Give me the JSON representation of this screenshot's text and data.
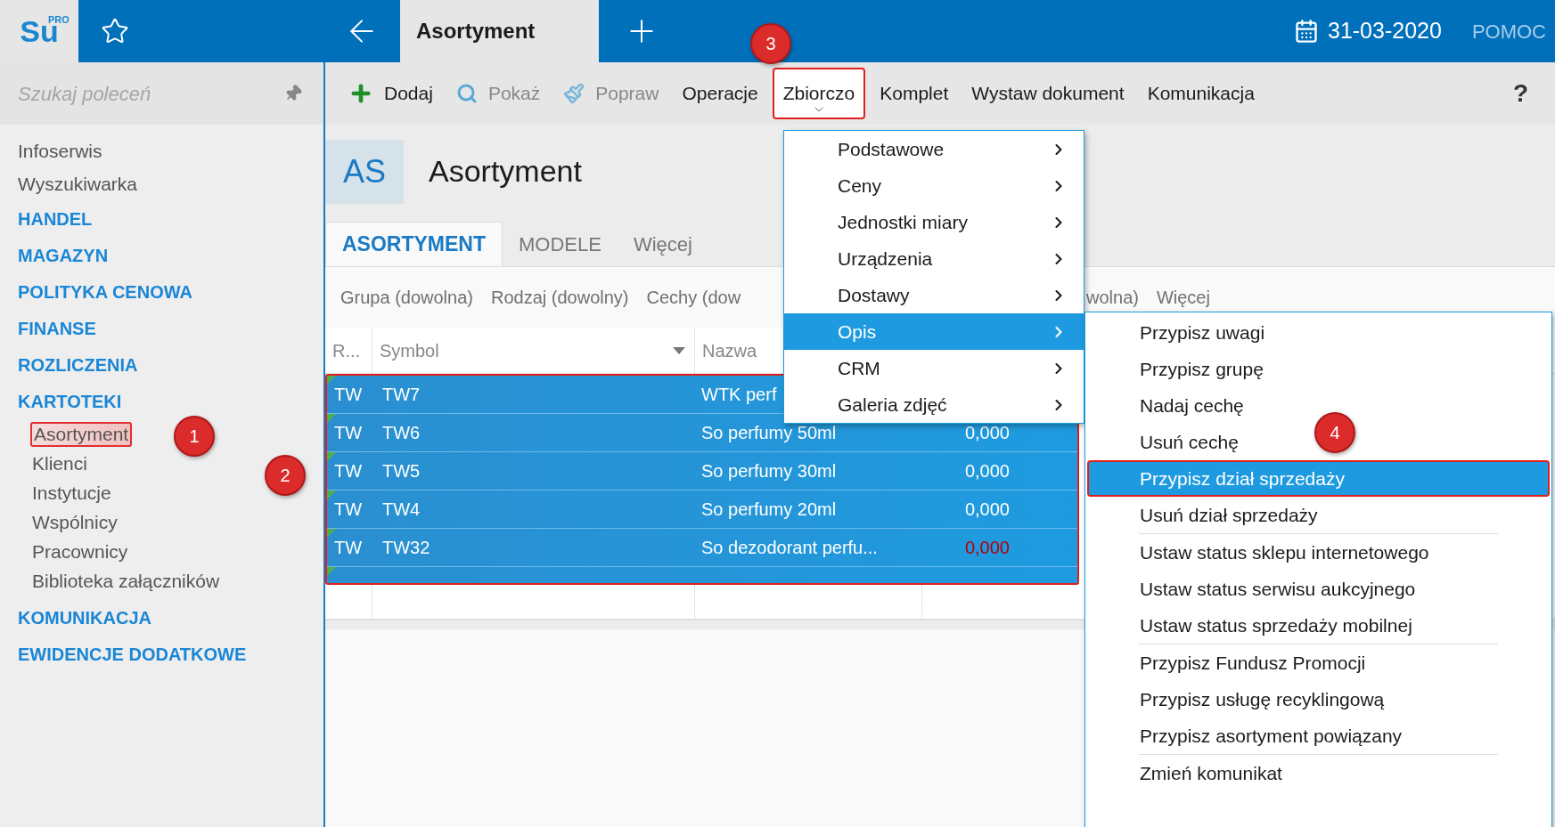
{
  "app": {
    "logo": "Su",
    "logo_badge": "PRO"
  },
  "top_bar": {
    "tab": "Asortyment",
    "date": "31-03-2020",
    "help": "POMOC"
  },
  "sidebar": {
    "search": {
      "placeholder": "Szukaj poleceń"
    },
    "items": [
      {
        "label": "Infoserwis",
        "kind": "link"
      },
      {
        "label": "Wyszukiwarka",
        "kind": "link"
      },
      {
        "label": "HANDEL",
        "kind": "section"
      },
      {
        "label": "MAGAZYN",
        "kind": "section"
      },
      {
        "label": "POLITYKA CENOWA",
        "kind": "section"
      },
      {
        "label": "FINANSE",
        "kind": "section"
      },
      {
        "label": "ROZLICZENIA",
        "kind": "section"
      },
      {
        "label": "KARTOTEKI",
        "kind": "section",
        "children": [
          {
            "label": "Asortyment",
            "highlighted": true
          },
          {
            "label": "Klienci",
            "highlighted": false
          },
          {
            "label": "Instytucje",
            "highlighted": false
          },
          {
            "label": "Wspólnicy",
            "highlighted": false
          },
          {
            "label": "Pracownicy",
            "highlighted": false
          },
          {
            "label": "Biblioteka załączników",
            "highlighted": false
          }
        ]
      },
      {
        "label": "KOMUNIKACJA",
        "kind": "section"
      },
      {
        "label": "EWIDENCJE DODATKOWE",
        "kind": "section"
      }
    ]
  },
  "toolbar": {
    "items": [
      {
        "label": "Dodaj",
        "kind": "add",
        "disabled": false,
        "highlighted": false
      },
      {
        "label": "Pokaż",
        "kind": "search",
        "disabled": true,
        "highlighted": false
      },
      {
        "label": "Popraw",
        "kind": "edit",
        "disabled": true,
        "highlighted": false
      },
      {
        "label": "Operacje",
        "kind": "plain",
        "disabled": false,
        "highlighted": false
      },
      {
        "label": "Zbiorczo",
        "kind": "dropdown",
        "disabled": false,
        "highlighted": true
      },
      {
        "label": "Komplet",
        "kind": "plain",
        "disabled": false,
        "highlighted": false
      },
      {
        "label": "Wystaw dokument",
        "kind": "plain",
        "disabled": false,
        "highlighted": false
      },
      {
        "label": "Komunikacja",
        "kind": "plain",
        "disabled": false,
        "highlighted": false
      }
    ],
    "help": "?"
  },
  "page": {
    "badge": "AS",
    "title": "Asortyment",
    "tabs": [
      {
        "label": "ASORTYMENT",
        "selected": true
      },
      {
        "label": "MODELE",
        "selected": false
      },
      {
        "label": "Więcej",
        "selected": false
      }
    ],
    "filters_left": [
      "Grupa (dowolna)",
      "Rodzaj (dowolny)",
      "Cechy (dow"
    ],
    "filters_right": [
      "wolna)",
      "Więcej"
    ]
  },
  "table": {
    "columns": [
      {
        "label": "R...",
        "sorted": false
      },
      {
        "label": "Symbol",
        "sorted": true
      },
      {
        "label": "Nazwa",
        "sorted": false
      }
    ],
    "outlined": true,
    "rows": [
      {
        "type": "TW",
        "symbol": "TW7",
        "name": "WTK perf",
        "selected": true
      },
      {
        "type": "TW",
        "symbol": "TW6",
        "name": "So perfumy 50ml",
        "value": "0,000",
        "negative": false,
        "selected": true
      },
      {
        "type": "TW",
        "symbol": "TW5",
        "name": "So perfumy 30ml",
        "value": "0,000",
        "negative": false,
        "selected": true
      },
      {
        "type": "TW",
        "symbol": "TW4",
        "name": "So perfumy 20ml",
        "value": "0,000",
        "negative": false,
        "selected": true
      },
      {
        "type": "TW",
        "symbol": "TW32",
        "name": "So dezodorant perfu...",
        "value": "0,000",
        "negative": true,
        "selected": true
      },
      {
        "selected": true
      }
    ]
  },
  "dropdown": {
    "items": [
      {
        "label": "Podstawowe",
        "selected": false
      },
      {
        "label": "Ceny",
        "selected": false
      },
      {
        "label": "Jednostki miary",
        "selected": false
      },
      {
        "label": "Urządzenia",
        "selected": false
      },
      {
        "label": "Dostawy",
        "selected": false
      },
      {
        "label": "Opis",
        "selected": true
      },
      {
        "label": "CRM",
        "selected": false
      },
      {
        "label": "Galeria zdjęć",
        "selected": false
      }
    ]
  },
  "submenu": {
    "groups": [
      [
        {
          "label": "Przypisz uwagi",
          "selected": false,
          "highlighted": false
        },
        {
          "label": "Przypisz grupę",
          "selected": false,
          "highlighted": false
        },
        {
          "label": "Nadaj cechę",
          "selected": false,
          "highlighted": false
        },
        {
          "label": "Usuń cechę",
          "selected": false,
          "highlighted": false
        },
        {
          "label": "Przypisz dział sprzedaży",
          "selected": true,
          "highlighted": true
        },
        {
          "label": "Usuń dział sprzedaży",
          "selected": false,
          "highlighted": false
        }
      ],
      [
        {
          "label": "Ustaw status sklepu internetowego",
          "selected": false,
          "highlighted": false
        },
        {
          "label": "Ustaw status serwisu aukcyjnego",
          "selected": false,
          "highlighted": false
        },
        {
          "label": "Ustaw status sprzedaży mobilnej",
          "selected": false,
          "highlighted": false
        }
      ],
      [
        {
          "label": "Przypisz Fundusz Promocji",
          "selected": false,
          "highlighted": false
        },
        {
          "label": "Przypisz usługę recyklingową",
          "selected": false,
          "highlighted": false
        },
        {
          "label": "Przypisz asortyment powiązany",
          "selected": false,
          "highlighted": false
        }
      ],
      [
        {
          "label": "Zmień komunikat",
          "selected": false,
          "highlighted": false
        }
      ]
    ]
  },
  "annotations": [
    {
      "label": "1"
    },
    {
      "label": "2"
    },
    {
      "label": "3"
    },
    {
      "label": "4"
    }
  ]
}
